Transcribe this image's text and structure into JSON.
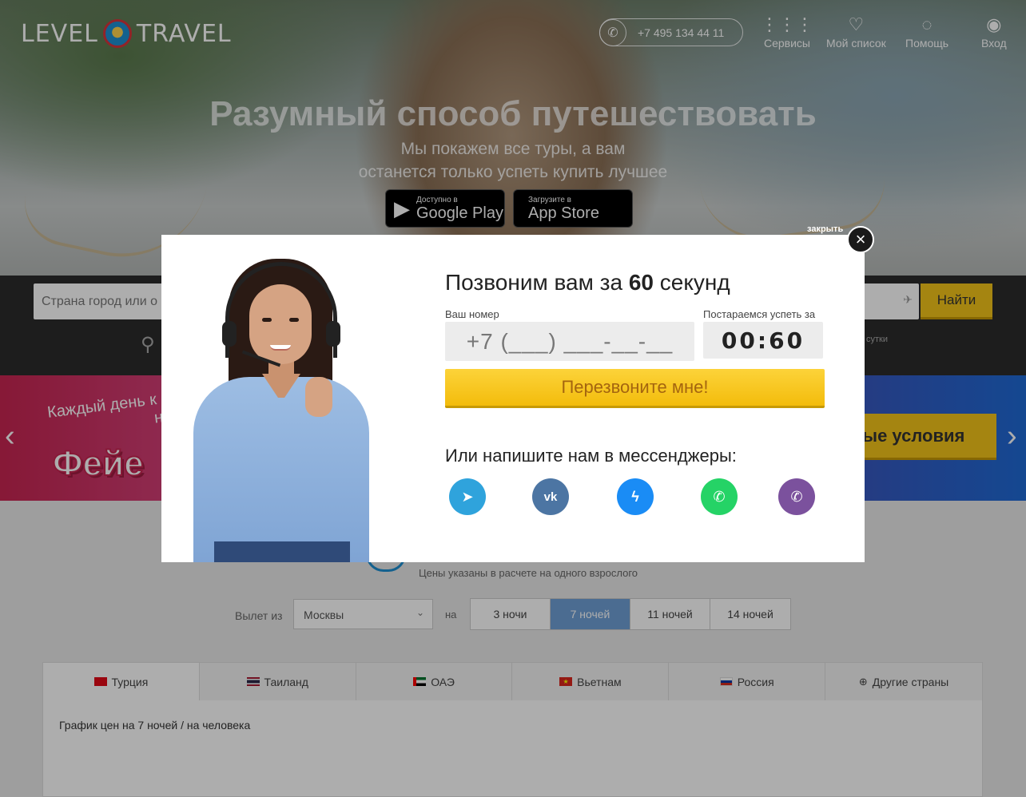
{
  "header": {
    "logo_left": "LEVEL",
    "logo_right": "TRAVEL",
    "phone": "+7 495 134 44 11",
    "nav": [
      {
        "label": "Сервисы",
        "icon": "grid-icon"
      },
      {
        "label": "Мой список",
        "icon": "heart-icon"
      },
      {
        "label": "Помощь",
        "icon": "help-bulb-icon"
      },
      {
        "label": "Вход",
        "icon": "user-icon"
      }
    ]
  },
  "hero": {
    "title": "Разумный способ путешествовать",
    "subtitle_line1": "Мы покажем все туры, а вам",
    "subtitle_line2": "останется только успеть купить лучшее",
    "google_small": "Доступно в",
    "google_big": "Google Play",
    "apple_small": "Загрузите в",
    "apple_big": "App Store"
  },
  "search": {
    "placeholder": "Страна город или о",
    "button": "Найти",
    "hint": "сутки"
  },
  "banner": {
    "line1": "Каждый день к",
    "line2": "н",
    "big": "Фейе",
    "button": "ные условия"
  },
  "section": {
    "subtitle": "Цены указаны в расчете на одного взрослого",
    "depart_label": "Вылет из",
    "city": "Москвы",
    "for_label": "на",
    "nights": [
      "3 ночи",
      "7 ночей",
      "11 ночей",
      "14 ночей"
    ],
    "active_nights": "7 ночей",
    "tabs": [
      {
        "label": "Турция",
        "flag": "#e30a17"
      },
      {
        "label": "Таиланд",
        "flag": "#2d2a4a"
      },
      {
        "label": "ОАЭ",
        "flag": "#00732f"
      },
      {
        "label": "Вьетнам",
        "flag": "#da251d"
      },
      {
        "label": "Россия",
        "flag": "#0039a6"
      },
      {
        "label": "Другие страны",
        "flag": ""
      }
    ],
    "chart_caption": "График цен на 7 ночей / на человека"
  },
  "modal": {
    "close_label": "закрыть",
    "title_prefix": "Позвоним вам за",
    "title_number": "60",
    "title_suffix": "секунд",
    "phone_label": "Ваш номер",
    "phone_placeholder": "+7 (___) ___-__-__",
    "timer_label": "Постараемся успеть за",
    "timer": "00:60",
    "call_button": "Перезвоните мне!",
    "messengers_title": "Или напишите нам в мессенджеры:",
    "messengers": [
      {
        "name": "telegram",
        "color": "#2fa3dc"
      },
      {
        "name": "vk",
        "color": "#4c75a3"
      },
      {
        "name": "messenger",
        "color": "#1a8cf5"
      },
      {
        "name": "whatsapp",
        "color": "#25d366"
      },
      {
        "name": "viber",
        "color": "#7b519d"
      }
    ]
  }
}
